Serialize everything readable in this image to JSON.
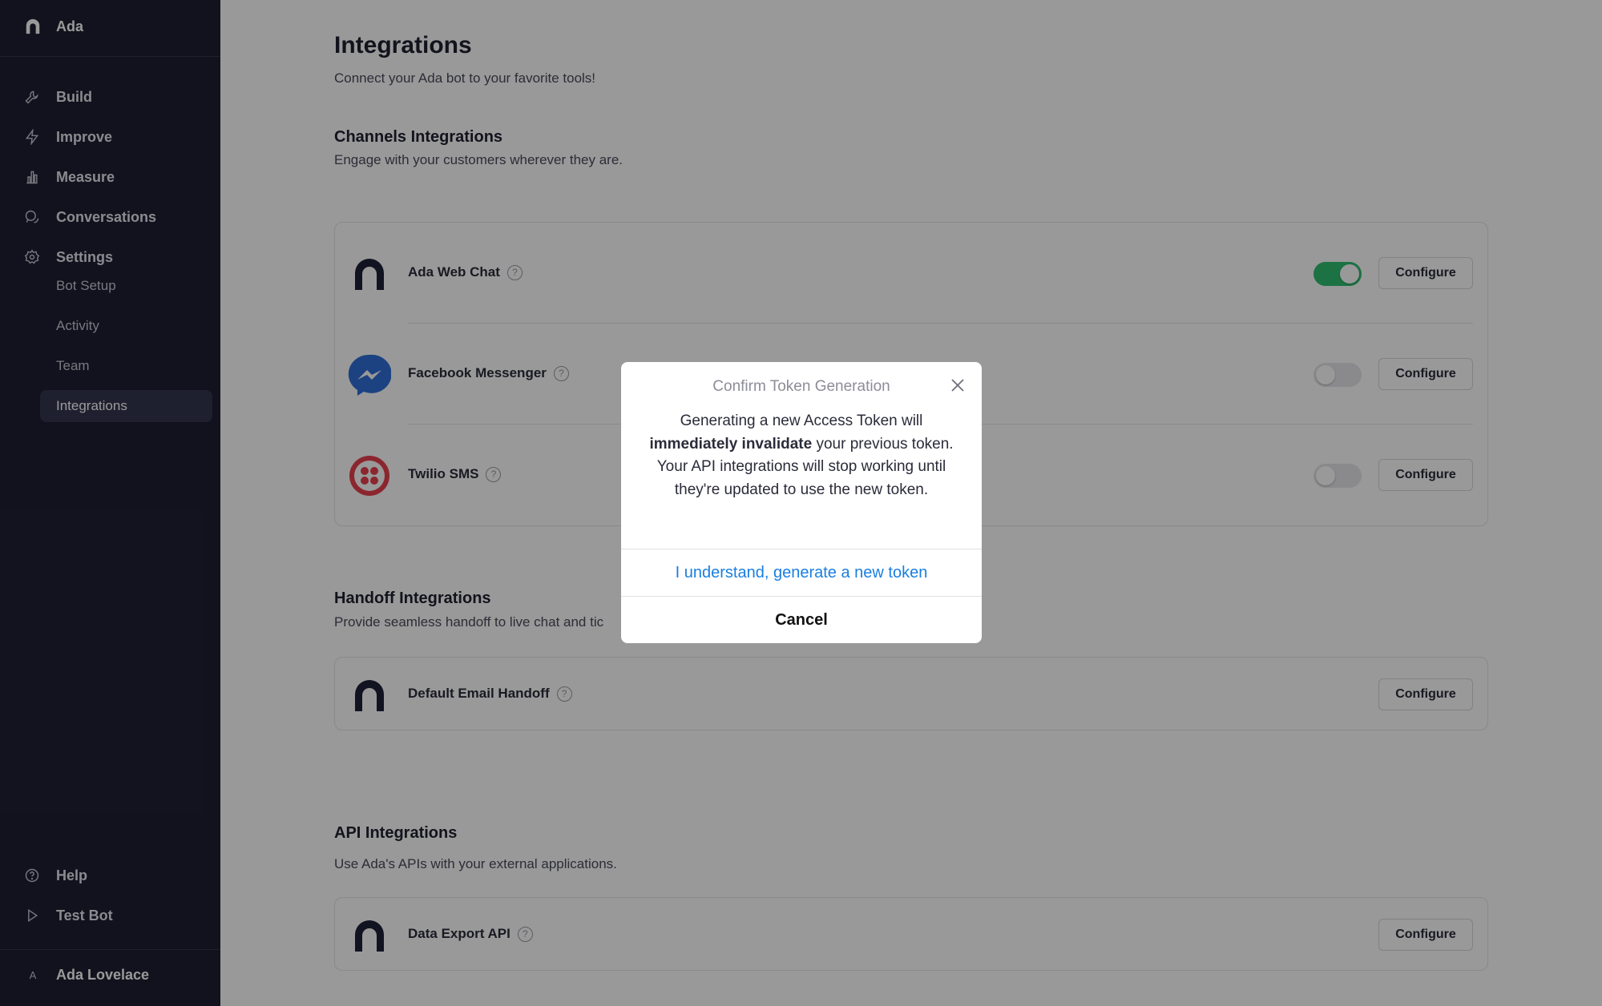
{
  "sidebar": {
    "brand": "Ada",
    "nav": [
      {
        "label": "Build",
        "icon": "wrench-icon"
      },
      {
        "label": "Improve",
        "icon": "lightning-icon"
      },
      {
        "label": "Measure",
        "icon": "bar-chart-icon"
      },
      {
        "label": "Conversations",
        "icon": "chat-bubbles-icon"
      },
      {
        "label": "Settings",
        "icon": "gear-icon"
      }
    ],
    "settings_sub": [
      {
        "label": "Bot Setup"
      },
      {
        "label": "Activity"
      },
      {
        "label": "Team"
      },
      {
        "label": "Integrations",
        "active": true
      }
    ],
    "bottom": [
      {
        "label": "Help",
        "icon": "question-circle-icon"
      },
      {
        "label": "Test Bot",
        "icon": "play-icon"
      }
    ],
    "user": {
      "initial": "A",
      "name": "Ada Lovelace"
    }
  },
  "main": {
    "title": "Integrations",
    "subtitle": "Connect your Ada bot to your favorite tools!",
    "channels": {
      "title": "Channels Integrations",
      "subtitle": "Engage with your customers wherever they are.",
      "items": [
        {
          "name": "Ada Web Chat",
          "logo": "ada-logo-icon",
          "enabled": true,
          "configure_label": "Configure"
        },
        {
          "name": "Facebook Messenger",
          "logo": "messenger-logo-icon",
          "enabled": false,
          "configure_label": "Configure"
        },
        {
          "name": "Twilio SMS",
          "logo": "twilio-logo-icon",
          "enabled": false,
          "configure_label": "Configure"
        }
      ]
    },
    "handoff": {
      "title": "Handoff Integrations",
      "subtitle": "Provide seamless handoff to live chat and tic",
      "items": [
        {
          "name": "Default Email Handoff",
          "logo": "ada-logo-icon",
          "configure_label": "Configure"
        }
      ]
    },
    "api": {
      "title": "API Integrations",
      "subtitle": "Use Ada's APIs with your external applications.",
      "items": [
        {
          "name": "Data Export API",
          "logo": "ada-logo-icon",
          "configure_label": "Configure"
        }
      ]
    }
  },
  "dialog": {
    "title": "Confirm Token Generation",
    "body_before": "Generating a new Access Token will ",
    "body_bold": "immediately invalidate",
    "body_after": " your previous token. Your API integrations will stop working until they're updated to use the new token.",
    "confirm_label": "I understand, generate a new token",
    "cancel_label": "Cancel"
  },
  "colors": {
    "sidebar_bg": "#1e1f33",
    "toggle_on": "#2fbf71",
    "link_blue": "#1a7fe0",
    "overlay": "rgba(0,0,0,0.40)"
  }
}
